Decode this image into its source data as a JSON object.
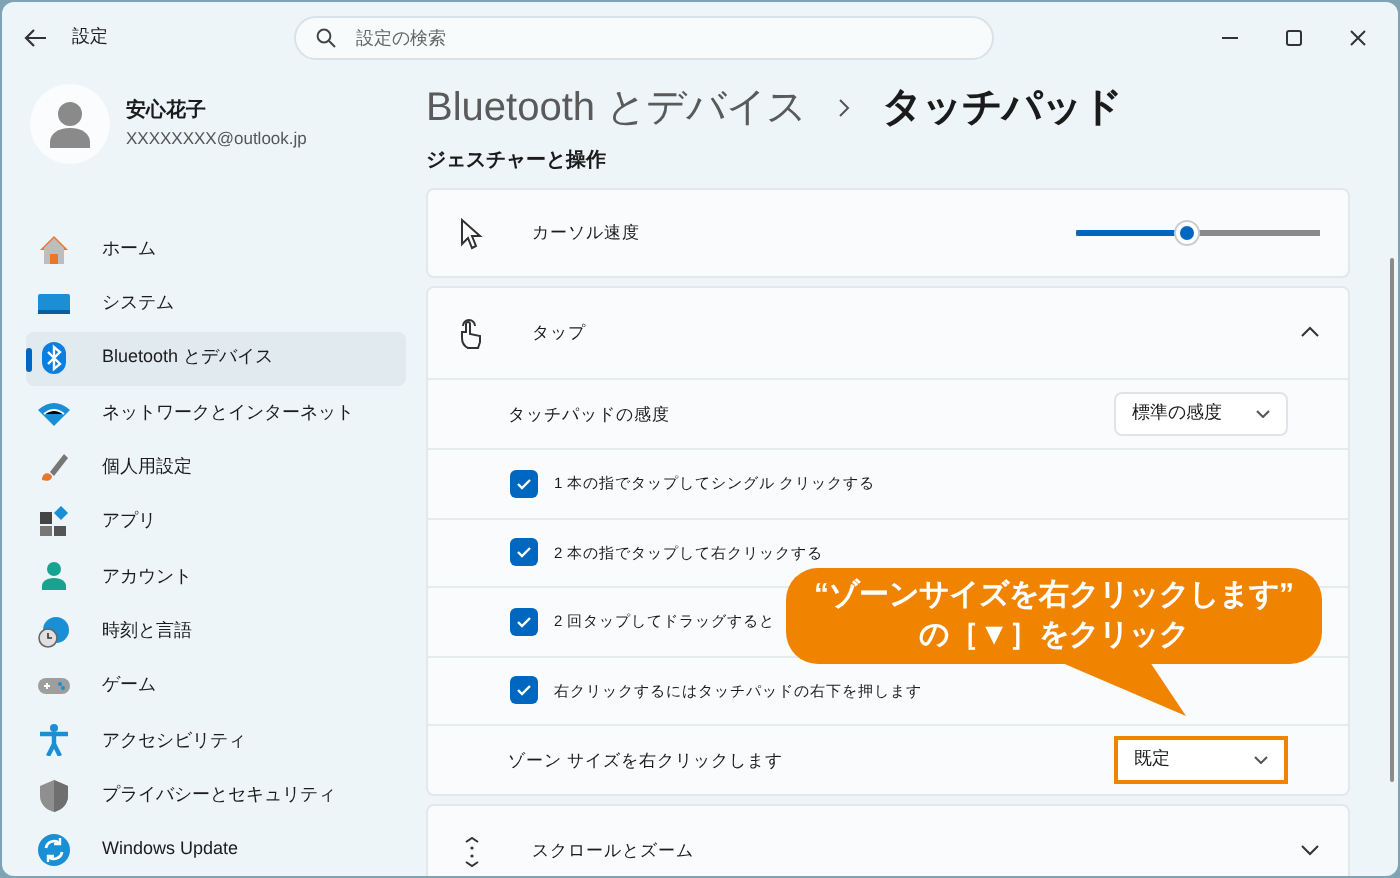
{
  "window": {
    "title": "設定"
  },
  "search": {
    "placeholder": "設定の検索"
  },
  "profile": {
    "name": "安心花子",
    "email": "XXXXXXXX@outlook.jp"
  },
  "sidebar": {
    "items": [
      {
        "label": "ホーム",
        "selected": false
      },
      {
        "label": "システム",
        "selected": false
      },
      {
        "label": "Bluetooth とデバイス",
        "selected": true
      },
      {
        "label": "ネットワークとインターネット",
        "selected": false
      },
      {
        "label": "個人用設定",
        "selected": false
      },
      {
        "label": "アプリ",
        "selected": false
      },
      {
        "label": "アカウント",
        "selected": false
      },
      {
        "label": "時刻と言語",
        "selected": false
      },
      {
        "label": "ゲーム",
        "selected": false
      },
      {
        "label": "アクセシビリティ",
        "selected": false
      },
      {
        "label": "プライバシーとセキュリティ",
        "selected": false
      },
      {
        "label": "Windows Update",
        "selected": false
      }
    ]
  },
  "breadcrumb": [
    {
      "label": "Bluetooth とデバイス",
      "current": false
    },
    {
      "label": "タッチパッド",
      "current": true
    }
  ],
  "section_title": "ジェスチャーと操作",
  "cards": [
    {
      "kind": "slider",
      "label": "カーソル速度",
      "level": 0.45
    },
    {
      "kind": "expander",
      "label": "タップ",
      "expanded": true,
      "rows": [
        {
          "kind": "dropdown",
          "label": "タッチパッドの感度",
          "value": "標準の感度",
          "highlighted": false
        },
        {
          "kind": "checkbox",
          "label": "1 本の指でタップしてシングル クリックする",
          "checked": true
        },
        {
          "kind": "checkbox",
          "label": "2 本の指でタップして右クリックする",
          "checked": true
        },
        {
          "kind": "checkbox",
          "label": "2 回タップしてドラッグすると",
          "checked": true
        },
        {
          "kind": "checkbox",
          "label": "右クリックするにはタッチパッドの右下を押します",
          "checked": true
        },
        {
          "kind": "dropdown",
          "label": "ゾーン サイズを右クリックします",
          "value": "既定",
          "highlighted": true
        }
      ]
    },
    {
      "kind": "expander",
      "label": "スクロールとズーム",
      "expanded": false
    }
  ],
  "callout": {
    "lines": [
      "“ゾーンサイズを右クリックします”",
      "の［▼］をクリック"
    ]
  }
}
